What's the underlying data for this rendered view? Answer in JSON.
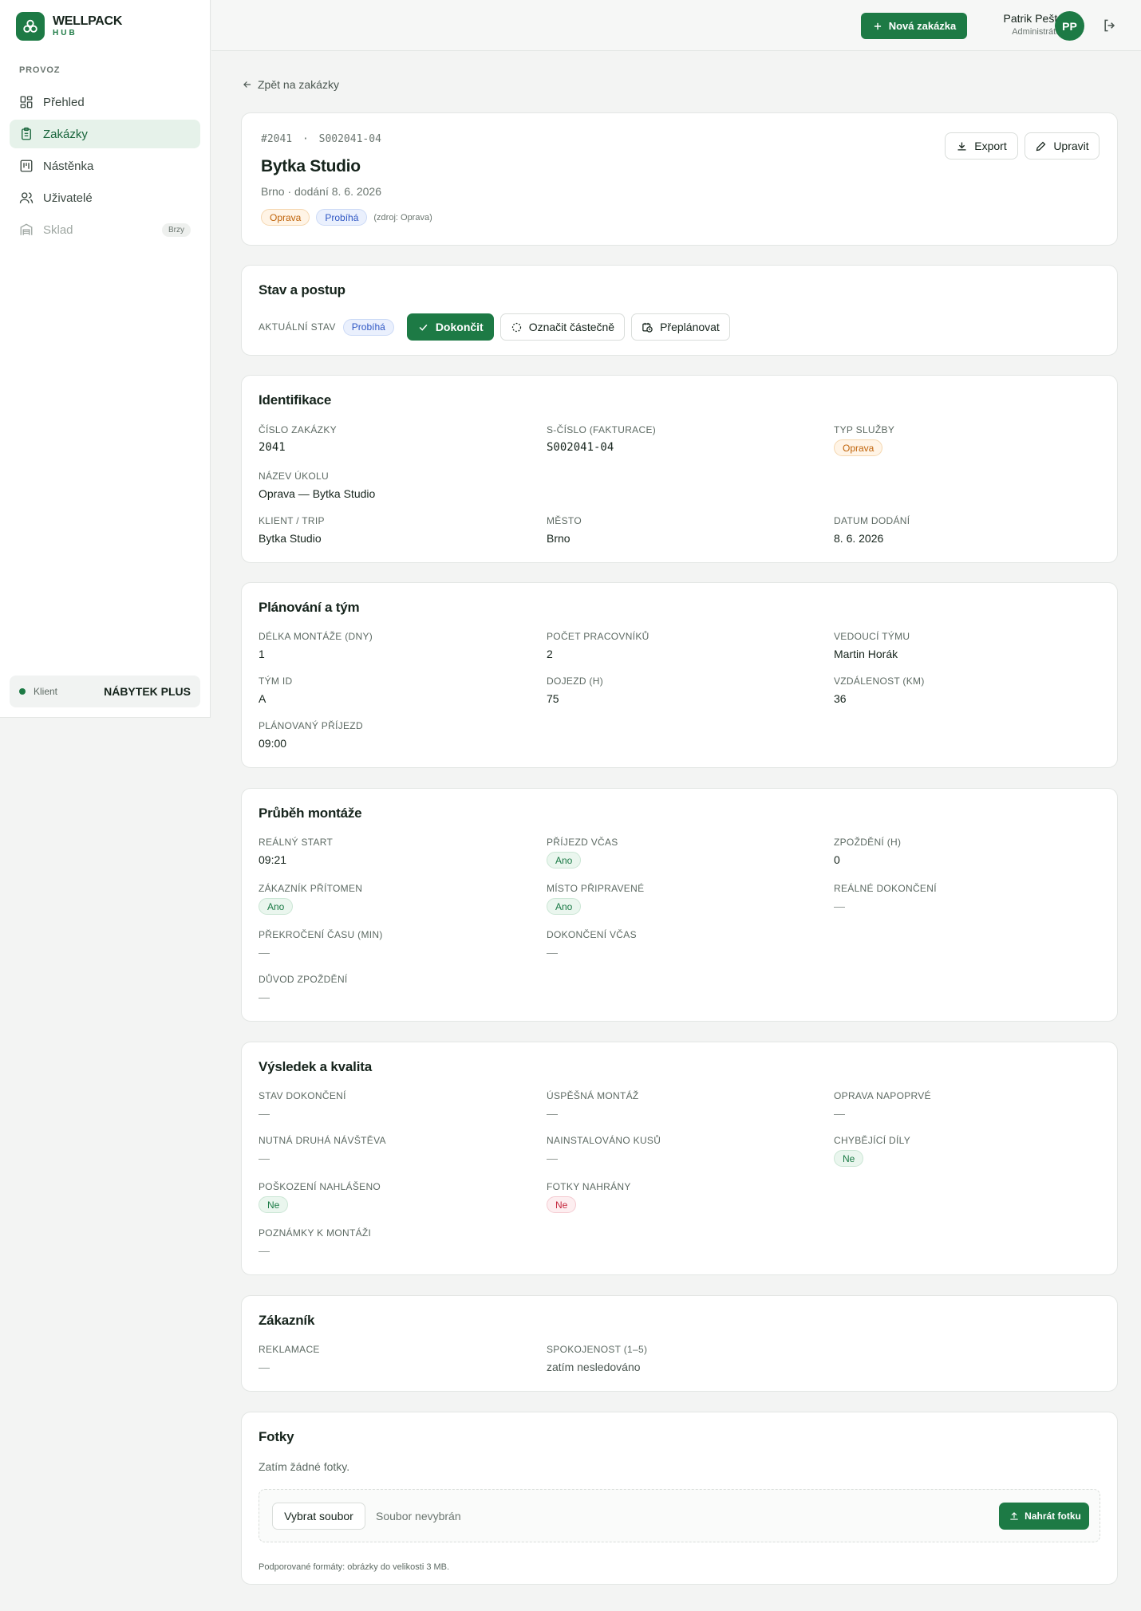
{
  "brand": {
    "name": "WELLPACK",
    "sub": "HUB"
  },
  "sidebar": {
    "section": "PROVOZ",
    "items": [
      {
        "label": "Přehled",
        "icon": "dashboard-icon"
      },
      {
        "label": "Zakázky",
        "icon": "clipboard-icon",
        "active": true
      },
      {
        "label": "Nástěnka",
        "icon": "board-icon"
      },
      {
        "label": "Uživatelé",
        "icon": "users-icon"
      },
      {
        "label": "Sklad",
        "icon": "warehouse-icon",
        "badge": "Brzy",
        "disabled": true
      }
    ],
    "client": {
      "label": "Klient",
      "value": "NÁBYTEK PLUS"
    }
  },
  "header": {
    "new_order": "Nová zakázka",
    "user_name": "Patrik Pešta",
    "user_role": "Administrátor",
    "avatar": "PP"
  },
  "back": "Zpět na zakázky",
  "order": {
    "number": "#2041",
    "sep": "·",
    "s_number": "S002041-04",
    "title": "Bytka Studio",
    "subtitle": "Brno · dodání 8. 6. 2026",
    "tag_type": "Oprava",
    "tag_status": "Probíhá",
    "source": "(zdroj: Oprava)",
    "export": "Export",
    "edit": "Upravit"
  },
  "state": {
    "title": "Stav a postup",
    "label": "AKTUÁLNÍ STAV",
    "current": "Probíhá",
    "complete": "Dokončit",
    "partial": "Označit částečně",
    "reschedule": "Přeplánovat"
  },
  "identification": {
    "title": "Identifikace",
    "order_no_label": "ČÍSLO ZAKÁZKY",
    "order_no": "2041",
    "s_no_label": "S-ČÍSLO (FAKTURACE)",
    "s_no": "S002041-04",
    "service_label": "TYP SLUŽBY",
    "service": "Oprava",
    "task_label": "NÁZEV ÚKOLU",
    "task": "Oprava — Bytka Studio",
    "client_label": "KLIENT / TRIP",
    "client": "Bytka Studio",
    "city_label": "MĚSTO",
    "city": "Brno",
    "delivery_label": "DATUM DODÁNÍ",
    "delivery": "8. 6. 2026"
  },
  "planning": {
    "title": "Plánování a tým",
    "length_label": "DÉLKA MONTÁŽE (DNY)",
    "length": "1",
    "workers_label": "POČET PRACOVNÍKŮ",
    "workers": "2",
    "lead_label": "VEDOUCÍ TÝMU",
    "lead": "Martin Horák",
    "team_label": "TÝM ID",
    "team": "A",
    "travel_label": "DOJEZD (H)",
    "travel": "75",
    "distance_label": "VZDÁLENOST (KM)",
    "distance": "36",
    "arrival_label": "PLÁNOVANÝ PŘÍJEZD",
    "arrival": "09:00"
  },
  "progress": {
    "title": "Průběh montáže",
    "start_label": "REÁLNÝ START",
    "start": "09:21",
    "ontime_label": "PŘÍJEZD VČAS",
    "ontime": "Ano",
    "delay_label": "ZPOŽDĚNÍ (H)",
    "delay": "0",
    "present_label": "ZÁKAZNÍK PŘÍTOMEN",
    "present": "Ano",
    "ready_label": "MÍSTO PŘIPRAVENÉ",
    "ready": "Ano",
    "finish_label": "REÁLNÉ DOKONČENÍ",
    "finish": "—",
    "overtime_label": "PŘEKROČENÍ ČASU (MIN)",
    "overtime": "—",
    "finish_ontime_label": "DOKONČENÍ VČAS",
    "finish_ontime": "—",
    "reason_label": "DŮVOD ZPOŽDĚNÍ",
    "reason": "—"
  },
  "result": {
    "title": "Výsledek a kvalita",
    "status_label": "STAV DOKONČENÍ",
    "status": "—",
    "success_label": "ÚSPĚŠNÁ MONTÁŽ",
    "success": "—",
    "firsttime_label": "OPRAVA NAPOPRVÉ",
    "firsttime": "—",
    "revisit_label": "NUTNÁ DRUHÁ NÁVŠTĚVA",
    "revisit": "—",
    "installed_label": "NAINSTALOVÁNO KUSŮ",
    "installed": "—",
    "missing_label": "CHYBĚJÍCÍ DÍLY",
    "missing": "Ne",
    "damage_label": "POŠKOZENÍ NAHLÁŠENO",
    "damage": "Ne",
    "photos_label": "FOTKY NAHRÁNY",
    "photos": "Ne",
    "notes_label": "POZNÁMKY K MONTÁŽI",
    "notes": "—"
  },
  "customer": {
    "title": "Zákazník",
    "complaint_label": "REKLAMACE",
    "complaint": "—",
    "satisfaction_label": "SPOKOJENOST (1–5)",
    "satisfaction": "zatím nesledováno"
  },
  "photos": {
    "title": "Fotky",
    "empty": "Zatím žádné fotky.",
    "choose": "Vybrat soubor",
    "no_file": "Soubor nevybrán",
    "upload": "Nahrát fotku",
    "formats": "Podporované formáty: obrázky do velikosti 3 MB."
  }
}
